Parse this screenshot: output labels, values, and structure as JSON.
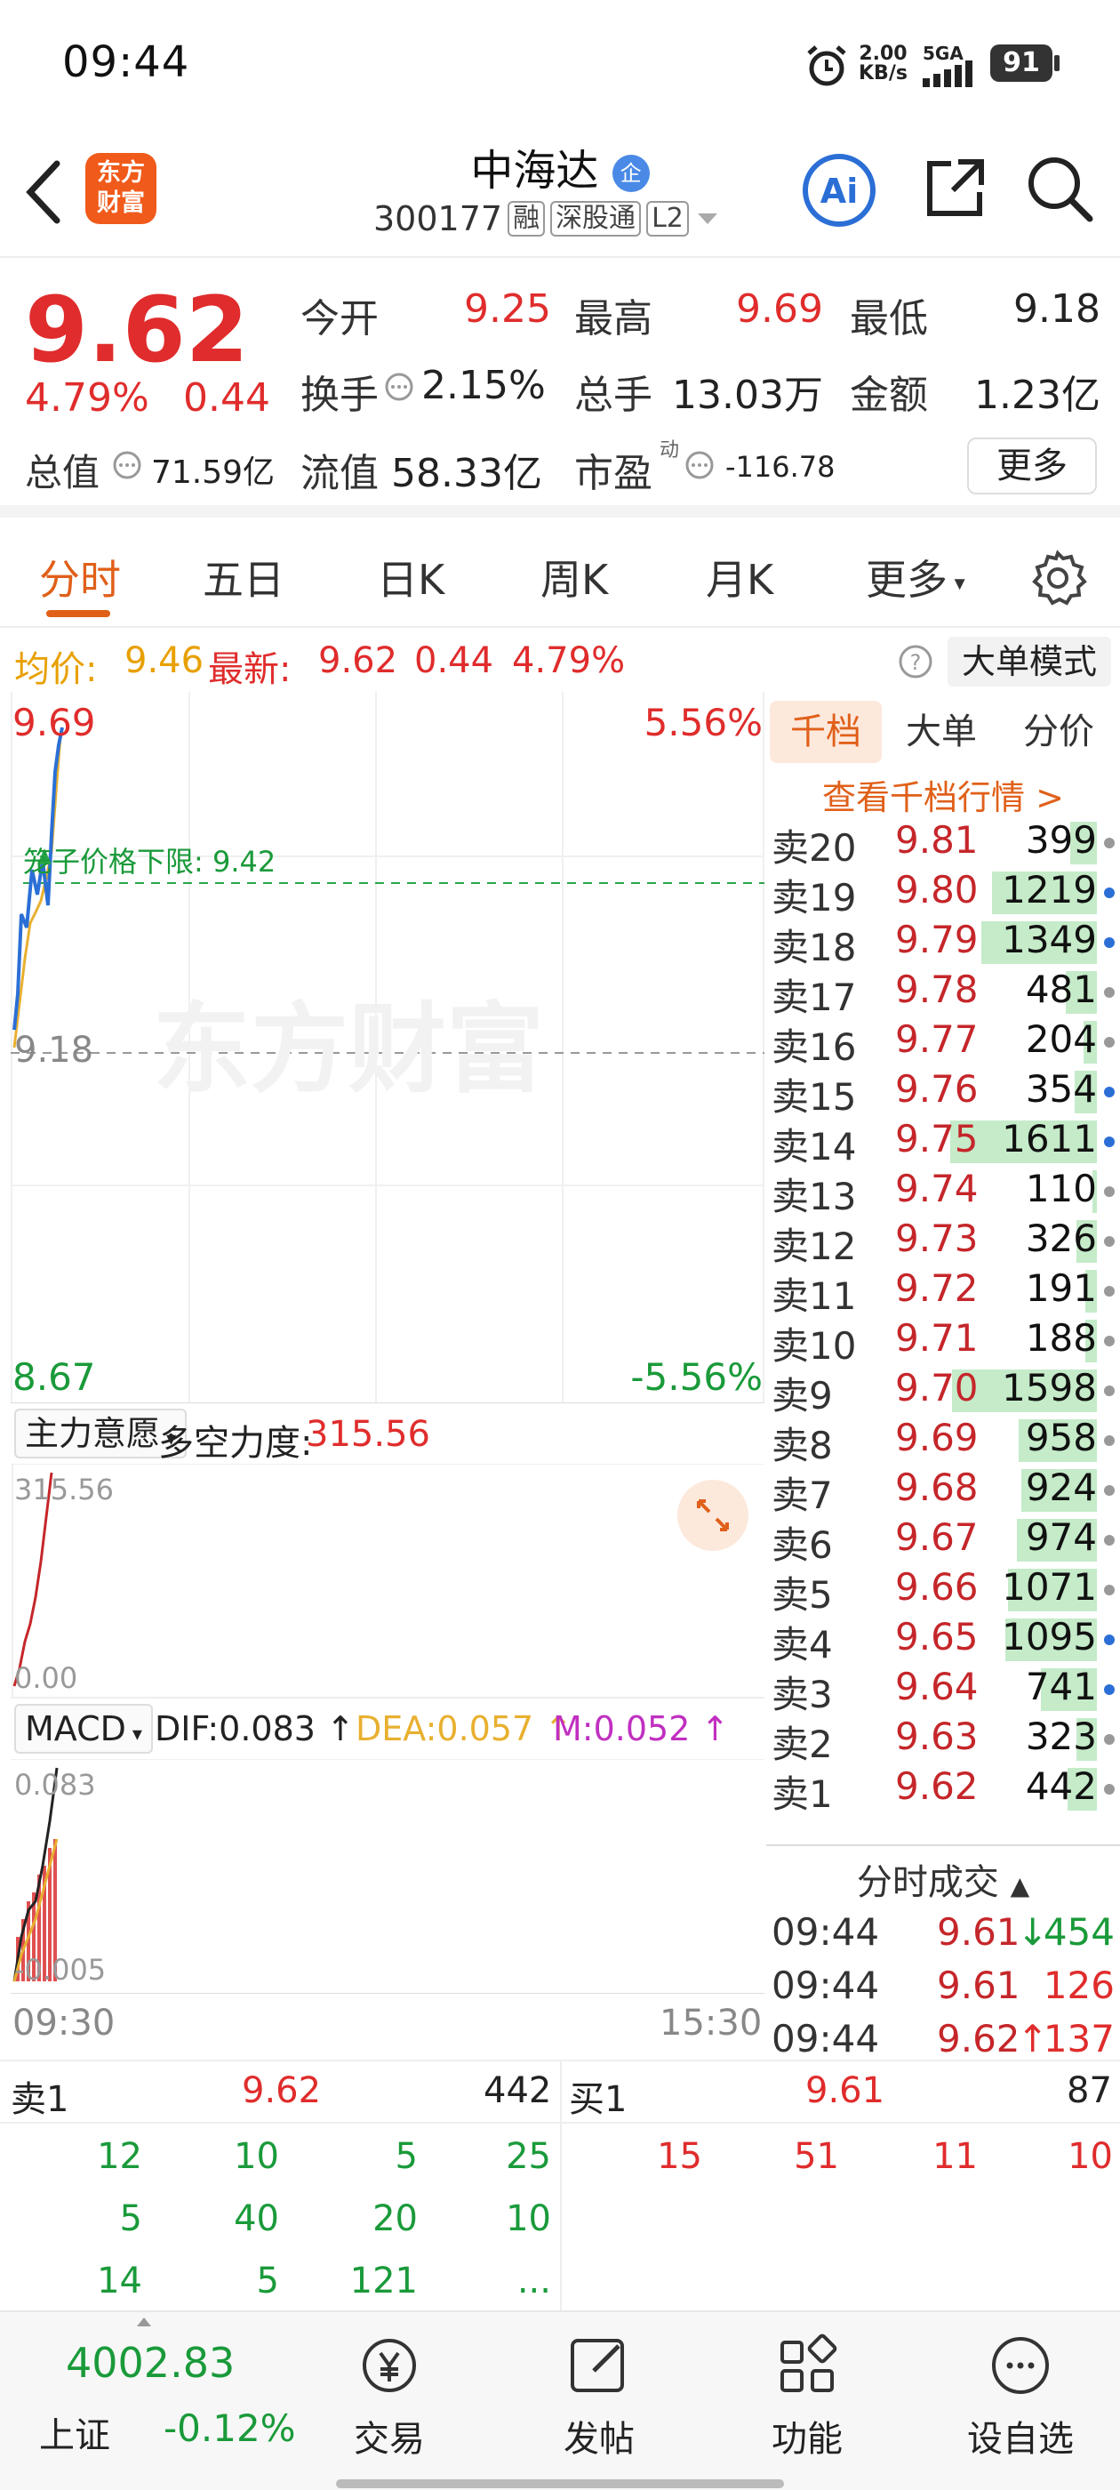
{
  "status_bar": {
    "time": "09:44",
    "net_speed_value": "2.00",
    "net_speed_unit": "KB/s",
    "network": "5GA",
    "battery": "91"
  },
  "header": {
    "logo_line1": "东方",
    "logo_line2": "财富",
    "stock_name": "中海达",
    "badge": "企",
    "code": "300177",
    "tag1": "融",
    "tag2": "深股通",
    "tag3": "L2"
  },
  "quote": {
    "price": "9.62",
    "change_pct": "4.79%",
    "change": "0.44",
    "open_label": "今开",
    "open": "9.25",
    "high_label": "最高",
    "high": "9.69",
    "low_label": "最低",
    "low": "9.18",
    "turnover_label": "换手",
    "turnover": "2.15%",
    "volume_label": "总手",
    "volume": "13.03万",
    "amount_label": "金额",
    "amount": "1.23亿",
    "mktcap_label": "总值",
    "mktcap": "71.59亿",
    "float_label": "流值",
    "float_cap": "58.33亿",
    "pe_label": "市盈",
    "pe_sup": "动",
    "pe": "-116.78",
    "more_label": "更多"
  },
  "tabs": [
    "分时",
    "五日",
    "日K",
    "周K",
    "月K",
    "更多"
  ],
  "avg_line": {
    "avg_label": "均价:",
    "avg": "9.46",
    "latest_label": "最新:",
    "latest": "9.62",
    "chg": "0.44",
    "chg_pct": "4.79%",
    "mode_button": "大单模式"
  },
  "chart": {
    "price_top": "9.69",
    "pct_top": "5.56%",
    "price_bottom": "8.67",
    "pct_bottom": "-5.56%",
    "mid_label": "9.18",
    "limit_label": "笼子价格下限:",
    "limit_value": "9.42",
    "watermark": "东方财富",
    "indicator_select": "主力意愿",
    "indicator_label": "多空力度:",
    "indicator_value": "315.56",
    "ind_top": "315.56",
    "ind_bottom": "0.00",
    "macd_select": "MACD",
    "dif": "DIF:0.083",
    "dea": "DEA:0.057",
    "m": "M:0.052",
    "macd_top": "0.083",
    "macd_bottom": "-0.005",
    "time_start": "09:30",
    "time_end": "15:30"
  },
  "book": {
    "tabs": [
      "千档",
      "大单",
      "分价"
    ],
    "view_link": "查看千档行情 >",
    "asks": [
      {
        "name": "卖20",
        "price": "9.81",
        "qty": "399",
        "bar": 0.12,
        "dot": "#999"
      },
      {
        "name": "卖19",
        "price": "9.80",
        "qty": "1219",
        "bar": 0.47,
        "dot": "#2b6fd6"
      },
      {
        "name": "卖18",
        "price": "9.79",
        "qty": "1349",
        "bar": 0.52,
        "dot": "#2b6fd6"
      },
      {
        "name": "卖17",
        "price": "9.78",
        "qty": "481",
        "bar": 0.14,
        "dot": "#999"
      },
      {
        "name": "卖16",
        "price": "9.77",
        "qty": "204",
        "bar": 0.06,
        "dot": "#999"
      },
      {
        "name": "卖15",
        "price": "9.76",
        "qty": "354",
        "bar": 0.1,
        "dot": "#2b6fd6"
      },
      {
        "name": "卖14",
        "price": "9.75",
        "qty": "1611",
        "bar": 0.66,
        "dot": "#2b6fd6"
      },
      {
        "name": "卖13",
        "price": "9.74",
        "qty": "110",
        "bar": 0.02,
        "dot": "#999"
      },
      {
        "name": "卖12",
        "price": "9.73",
        "qty": "326",
        "bar": 0.09,
        "dot": "#999"
      },
      {
        "name": "卖11",
        "price": "9.72",
        "qty": "191",
        "bar": 0.05,
        "dot": "#999"
      },
      {
        "name": "卖10",
        "price": "9.71",
        "qty": "188",
        "bar": 0.05,
        "dot": "#999"
      },
      {
        "name": "卖9",
        "price": "9.70",
        "qty": "1598",
        "bar": 0.65,
        "dot": "#999"
      },
      {
        "name": "卖8",
        "price": "9.69",
        "qty": "958",
        "bar": 0.35,
        "dot": "#999"
      },
      {
        "name": "卖7",
        "price": "9.68",
        "qty": "924",
        "bar": 0.34,
        "dot": "#999"
      },
      {
        "name": "卖6",
        "price": "9.67",
        "qty": "974",
        "bar": 0.36,
        "dot": "#999"
      },
      {
        "name": "卖5",
        "price": "9.66",
        "qty": "1071",
        "bar": 0.4,
        "dot": "#999"
      },
      {
        "name": "卖4",
        "price": "9.65",
        "qty": "1095",
        "bar": 0.41,
        "dot": "#2b6fd6"
      },
      {
        "name": "卖3",
        "price": "9.64",
        "qty": "741",
        "bar": 0.25,
        "dot": "#2b6fd6"
      },
      {
        "name": "卖2",
        "price": "9.63",
        "qty": "323",
        "bar": 0.09,
        "dot": "#999"
      },
      {
        "name": "卖1",
        "price": "9.62",
        "qty": "442",
        "bar": 0.13,
        "dot": "#999"
      }
    ],
    "trades_title": "分时成交",
    "trades": [
      {
        "time": "09:44",
        "price": "9.61",
        "arrow": "↓",
        "qty": "454",
        "qty_color": "#1a9a3a"
      },
      {
        "time": "09:44",
        "price": "9.61",
        "arrow": "",
        "qty": "126",
        "qty_color": "#e02c2c"
      },
      {
        "time": "09:44",
        "price": "9.62",
        "arrow": "↑",
        "qty": "137",
        "qty_color": "#e02c2c"
      }
    ]
  },
  "level": {
    "sell_label": "卖1",
    "sell_price": "9.62",
    "sell_qty": "442",
    "buy_label": "买1",
    "buy_price": "9.61",
    "buy_qty": "87",
    "sell_grid": [
      [
        "12",
        "10",
        "5",
        "25"
      ],
      [
        "5",
        "40",
        "20",
        "10"
      ],
      [
        "14",
        "5",
        "121",
        "..."
      ]
    ],
    "buy_grid": [
      [
        "15",
        "51",
        "11",
        "10"
      ]
    ]
  },
  "nav": {
    "index_value": "4002.83",
    "index_name": "上证",
    "index_change": "-0.12%",
    "items": [
      "交易",
      "发帖",
      "功能",
      "设自选"
    ]
  }
}
